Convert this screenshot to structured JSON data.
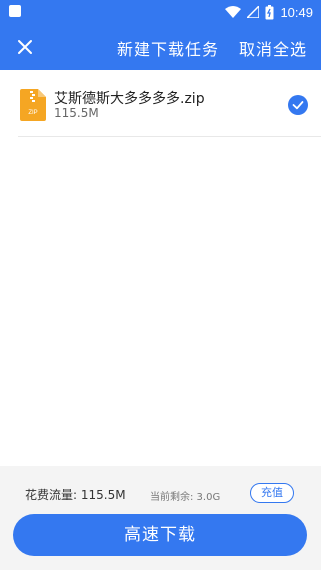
{
  "status_bar": {
    "time": "10:49",
    "icons": [
      "wifi-icon",
      "signal-icon",
      "battery-icon"
    ]
  },
  "toolbar": {
    "title": "新建下载任务",
    "cancel_select_all": "取消全选",
    "close_icon": "close-icon"
  },
  "files": [
    {
      "name": "艾斯德斯大多多多多.zip",
      "size": "115.5M",
      "icon": "zip-file-icon",
      "selected": true
    }
  ],
  "footer": {
    "cost_label": "花费流量: 115.5M",
    "remaining_label": "当前剩余: 3.0G",
    "recharge_label": "充值",
    "download_label": "高速下载"
  },
  "colors": {
    "accent": "#3478f0",
    "zip_icon": "#f5a623"
  }
}
